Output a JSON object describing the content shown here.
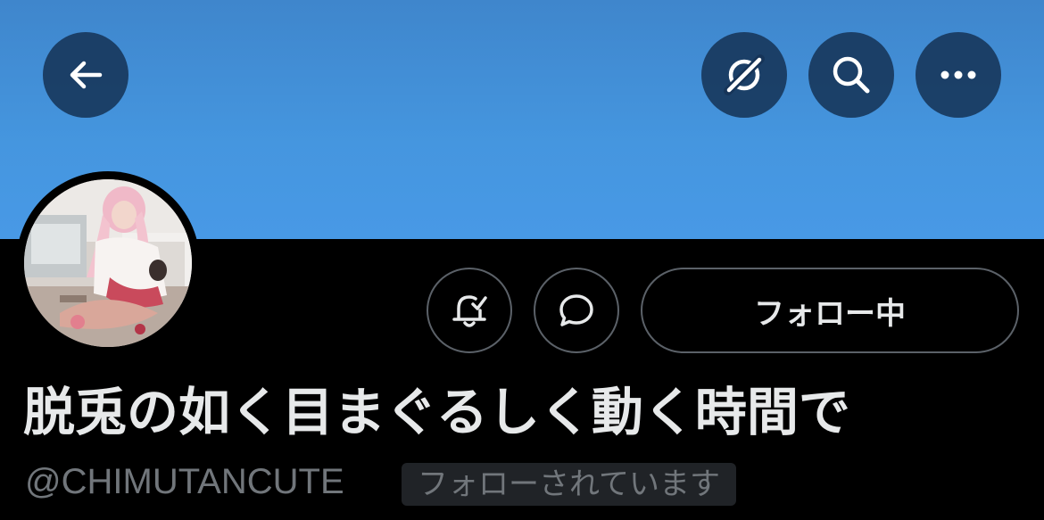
{
  "header": {
    "back_icon": "arrow-left-icon",
    "translate_icon": "translate-off-icon",
    "search_icon": "search-icon",
    "more_icon": "more-horizontal-icon",
    "banner_color": "#4596df"
  },
  "profile": {
    "display_name": "脱兎の如く目まぐるしく動く時間で",
    "handle": "@CHIMUTANCUTE",
    "follows_you_label": "フォローされています"
  },
  "actions": {
    "bell_icon": "bell-check-icon",
    "message_icon": "message-bubble-icon",
    "follow_label": "フォロー中"
  }
}
